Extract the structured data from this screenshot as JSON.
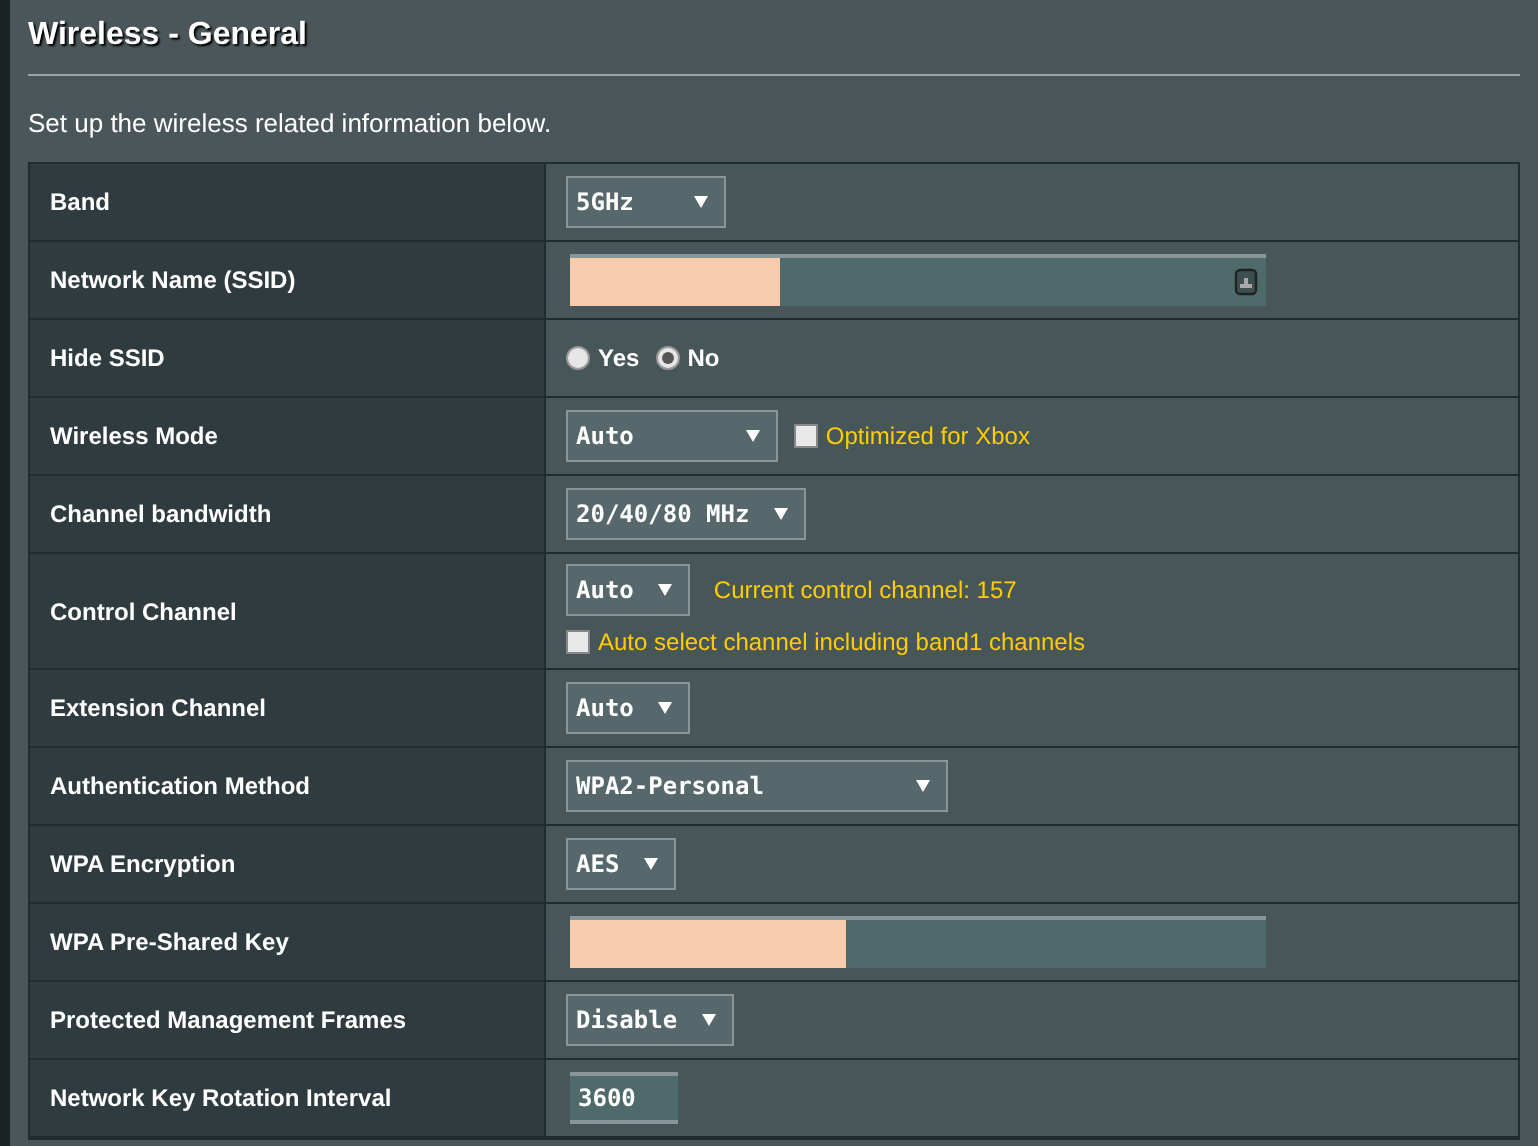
{
  "title": "Wireless - General",
  "subtitle": "Set up the wireless related information below.",
  "rows": [
    {
      "label": "Band",
      "kind": "select",
      "value": "5GHz"
    },
    {
      "label": "Network Name (SSID)",
      "kind": "text",
      "redacted": true
    },
    {
      "label": "Hide SSID",
      "kind": "radio",
      "options": [
        {
          "label": "Yes",
          "selected": false
        },
        {
          "label": "No",
          "selected": true
        }
      ]
    },
    {
      "label": "Wireless Mode",
      "kind": "select",
      "value": "Auto",
      "checkbox": {
        "label": "Optimized for Xbox",
        "checked": false
      }
    },
    {
      "label": "Channel bandwidth",
      "kind": "select",
      "value": "20/40/80 MHz"
    },
    {
      "label": "Control Channel",
      "kind": "select",
      "value": "Auto",
      "note": "Current control channel: 157",
      "checkbox": {
        "label": "Auto select channel including band1 channels",
        "checked": false
      }
    },
    {
      "label": "Extension Channel",
      "kind": "select",
      "value": "Auto"
    },
    {
      "label": "Authentication Method",
      "kind": "select",
      "value": "WPA2-Personal"
    },
    {
      "label": "WPA Encryption",
      "kind": "select",
      "value": "AES"
    },
    {
      "label": "WPA Pre-Shared Key",
      "kind": "password",
      "redacted": true
    },
    {
      "label": "Protected Management Frames",
      "kind": "select",
      "value": "Disable"
    },
    {
      "label": "Network Key Rotation Interval",
      "kind": "short",
      "value": "3600"
    }
  ]
}
